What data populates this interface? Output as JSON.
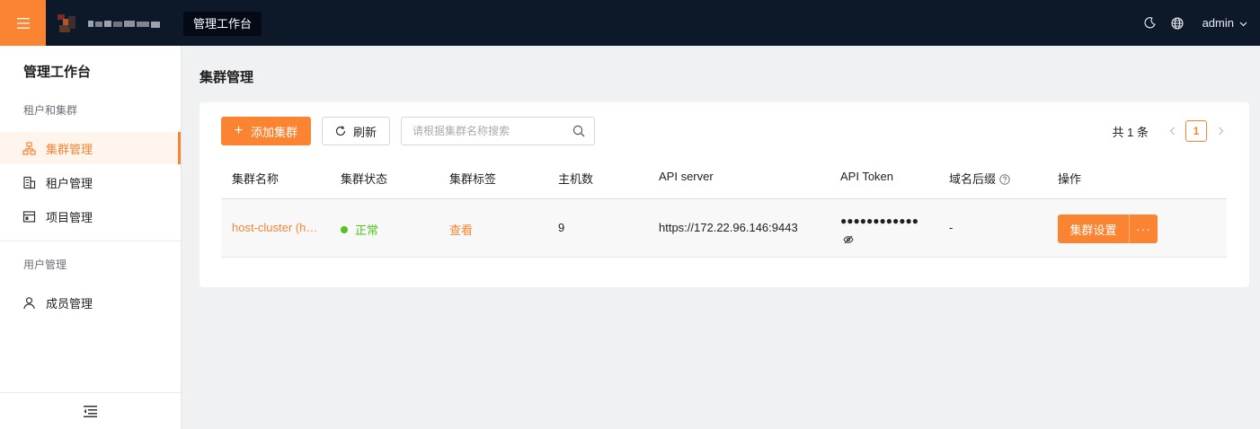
{
  "colors": {
    "accent": "#fa8432",
    "topbar": "#0d1829",
    "success": "#52c41a"
  },
  "topbar": {
    "menu_icon": "hamburger-icon",
    "workspace_tab": "管理工作台",
    "theme_icon": "moon-icon",
    "language_icon": "globe-icon",
    "user": "admin",
    "user_caret": "chevron-down-icon"
  },
  "sidebar": {
    "title": "管理工作台",
    "groups": [
      {
        "label": "租户和集群",
        "items": [
          {
            "label": "集群管理",
            "icon": "cluster-icon",
            "active": true
          },
          {
            "label": "租户管理",
            "icon": "building-icon",
            "active": false
          },
          {
            "label": "项目管理",
            "icon": "window-icon",
            "active": false
          }
        ]
      },
      {
        "label": "用户管理",
        "items": [
          {
            "label": "成员管理",
            "icon": "user-icon",
            "active": false
          }
        ]
      }
    ],
    "collapse_icon": "collapse-menu-icon"
  },
  "main": {
    "title": "集群管理",
    "toolbar": {
      "add_label": "添加集群",
      "refresh_label": "刷新",
      "search_placeholder": "请根据集群名称搜索",
      "search_value": ""
    },
    "pagination": {
      "total_text": "共 1 条",
      "current_page": "1"
    },
    "table": {
      "headers": [
        "集群名称",
        "集群状态",
        "集群标签",
        "主机数",
        "API server",
        "API Token",
        "域名后缀",
        "操作"
      ],
      "rows": [
        {
          "name": "host-cluster (host-cluster)",
          "status": "正常",
          "tags": "查看",
          "hosts": "9",
          "api_server": "https://172.22.96.146:9443",
          "api_token": "●●●●●●●●●●●●",
          "domain_suffix": "-",
          "settings_label": "集群设置",
          "more_label": "···"
        }
      ]
    }
  }
}
